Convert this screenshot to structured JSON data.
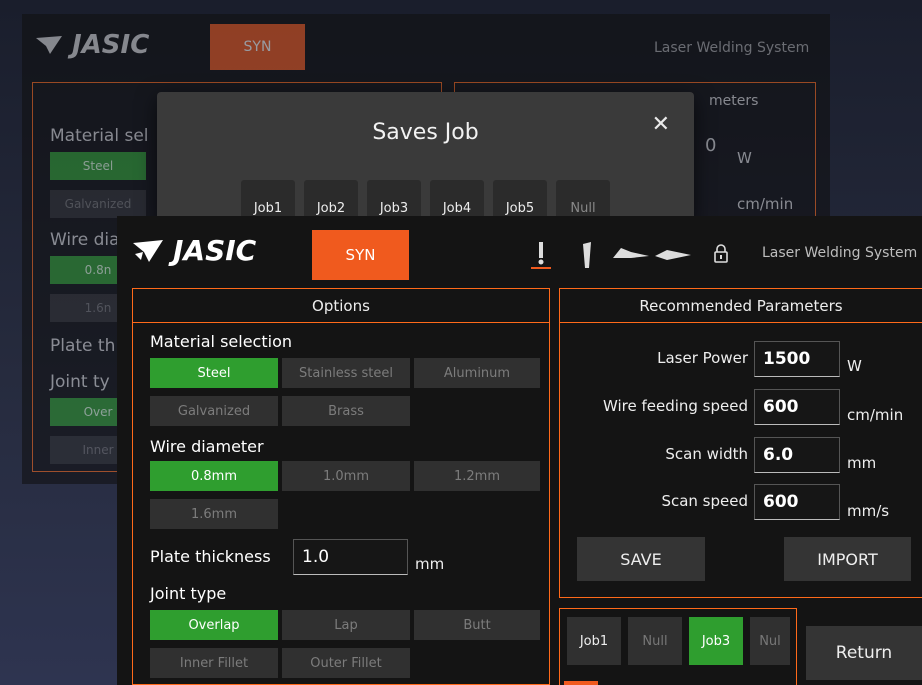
{
  "app": {
    "brand": "JASIC",
    "mode_label": "SYN",
    "system_title": "Laser Welding System",
    "colors": {
      "accent": "#f05a1e",
      "panel_border": "#ff6a1a",
      "selected": "#2f9e2f"
    }
  },
  "background_window": {
    "options_title_partial": "meters",
    "material_label": "Material sel",
    "steel_label": "Steel",
    "galvanized_label": "Galvanized",
    "wire_label": "Wire dia",
    "wire_value": "0.8n",
    "wire_value2": "1.6n",
    "plate_label": "Plate th",
    "joint_label": "Joint ty",
    "over_label": "Over",
    "inner_label": "Inner",
    "power_value": "0",
    "unit_w": "W",
    "unit_cm": "cm/min"
  },
  "modal": {
    "title": "Saves Job",
    "close_icon": "close-icon",
    "jobs": [
      "Job1",
      "Job2",
      "Job3",
      "Job4",
      "Job5",
      "Null"
    ]
  },
  "options": {
    "title": "Options",
    "material_label": "Material selection",
    "materials": [
      "Steel",
      "Stainless steel",
      "Aluminum",
      "Galvanized",
      "Brass"
    ],
    "selected_material": "Steel",
    "wire_label": "Wire diameter",
    "wires": [
      "0.8mm",
      "1.0mm",
      "1.2mm",
      "1.6mm"
    ],
    "selected_wire": "0.8mm",
    "plate_label": "Plate thickness",
    "plate_value": "1.0",
    "plate_unit": "mm",
    "joint_label": "Joint type",
    "joints": [
      "Overlap",
      "Lap",
      "Butt",
      "Inner Fillet",
      "Outer Fillet"
    ],
    "selected_joint": "Overlap"
  },
  "params": {
    "title": "Recommended  Parameters",
    "laser_power": {
      "label": "Laser Power",
      "value": "1500",
      "unit": "W"
    },
    "wire_speed": {
      "label": "Wire feeding speed",
      "value": "600",
      "unit": "cm/min"
    },
    "scan_width": {
      "label": "Scan width",
      "value": "6.0",
      "unit": "mm"
    },
    "scan_speed": {
      "label": "Scan speed",
      "value": "600",
      "unit": "mm/s"
    },
    "save_label": "SAVE",
    "import_label": "IMPORT"
  },
  "job_strip": {
    "tabs": [
      "Job1",
      "Null",
      "Job3",
      "Nul"
    ],
    "selected": "Job3",
    "return_label": "Return"
  },
  "icons": [
    "torch-icon",
    "nozzle-icon",
    "laser-gun-icon",
    "wire-feeder-icon",
    "lock-icon"
  ]
}
